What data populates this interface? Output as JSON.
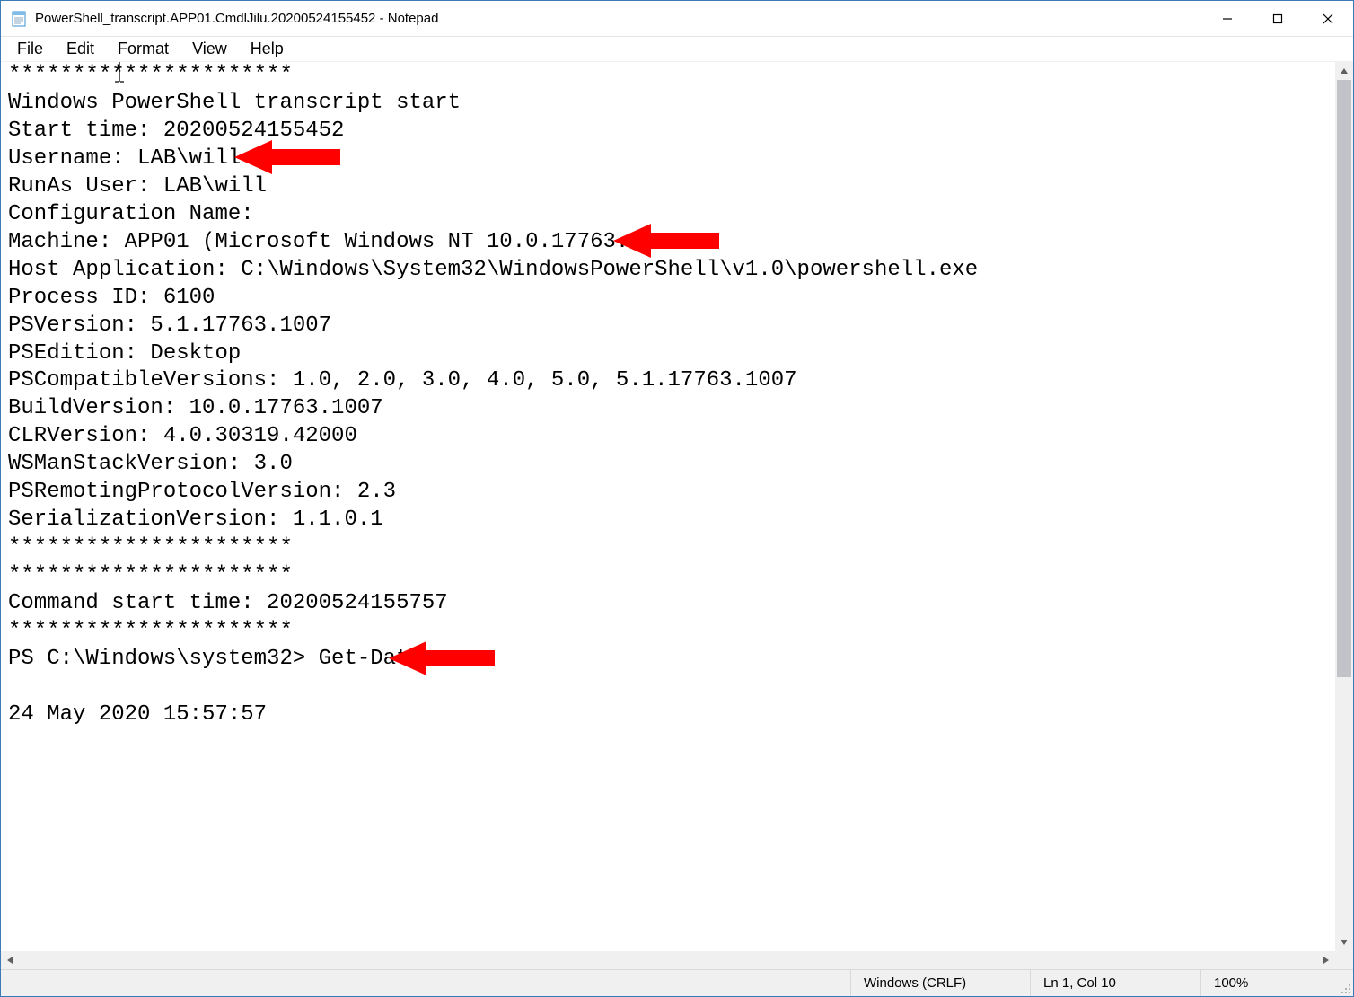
{
  "window": {
    "title": "PowerShell_transcript.APP01.CmdlJilu.20200524155452 - Notepad"
  },
  "menu": {
    "file": "File",
    "edit": "Edit",
    "format": "Format",
    "view": "View",
    "help": "Help"
  },
  "content_lines": [
    "**********************",
    "Windows PowerShell transcript start",
    "Start time: 20200524155452",
    "Username: LAB\\will",
    "RunAs User: LAB\\will",
    "Configuration Name:",
    "Machine: APP01 (Microsoft Windows NT 10.0.17763.0)",
    "Host Application: C:\\Windows\\System32\\WindowsPowerShell\\v1.0\\powershell.exe",
    "Process ID: 6100",
    "PSVersion: 5.1.17763.1007",
    "PSEdition: Desktop",
    "PSCompatibleVersions: 1.0, 2.0, 3.0, 4.0, 5.0, 5.1.17763.1007",
    "BuildVersion: 10.0.17763.1007",
    "CLRVersion: 4.0.30319.42000",
    "WSManStackVersion: 3.0",
    "PSRemotingProtocolVersion: 2.3",
    "SerializationVersion: 1.1.0.1",
    "**********************",
    "**********************",
    "Command start time: 20200524155757",
    "**********************",
    "PS C:\\Windows\\system32> Get-Date",
    "",
    "24 May 2020 15:57:57",
    "",
    ""
  ],
  "status": {
    "line_ending": "Windows (CRLF)",
    "cursor": "Ln 1, Col 10",
    "zoom": "100%"
  },
  "annotations": {
    "arrow_color": "#ff0000"
  }
}
